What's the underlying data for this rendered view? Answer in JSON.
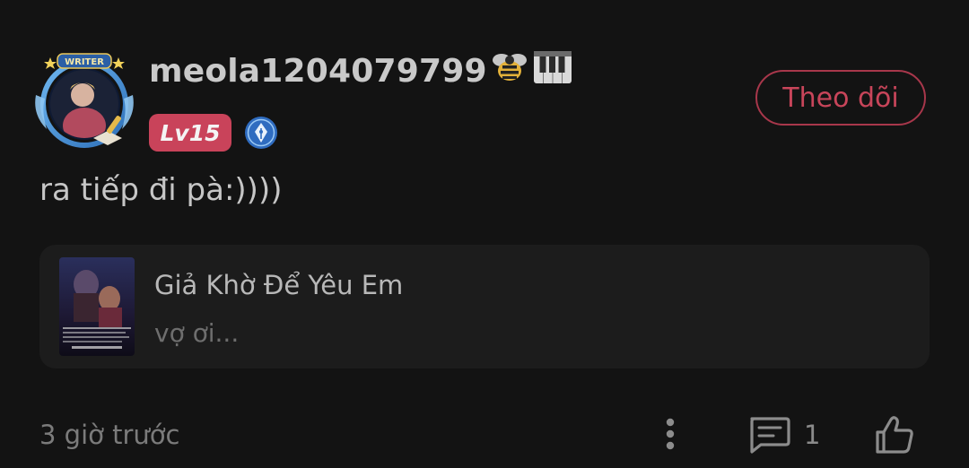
{
  "comment": {
    "username": "meola1204079799",
    "username_emojis": [
      "bee-icon",
      "piano-icon"
    ],
    "avatar_frame_label": "WRITER",
    "level": "Lv15",
    "level_color": "#c9435a",
    "writer_badge": "pen-nib-icon",
    "follow_label": "Theo dõi",
    "follow_color": "#c8455a",
    "text": "ra tiếp đi pà:))))",
    "timestamp": "3 giờ trước",
    "reply_count": "1"
  },
  "story": {
    "title": "Giả Khờ Để Yêu Em",
    "snippet": "vợ ơi..."
  },
  "actions": {
    "more_icon": "more-vertical-icon",
    "reply_icon": "comment-icon",
    "like_icon": "thumbs-up-icon"
  }
}
